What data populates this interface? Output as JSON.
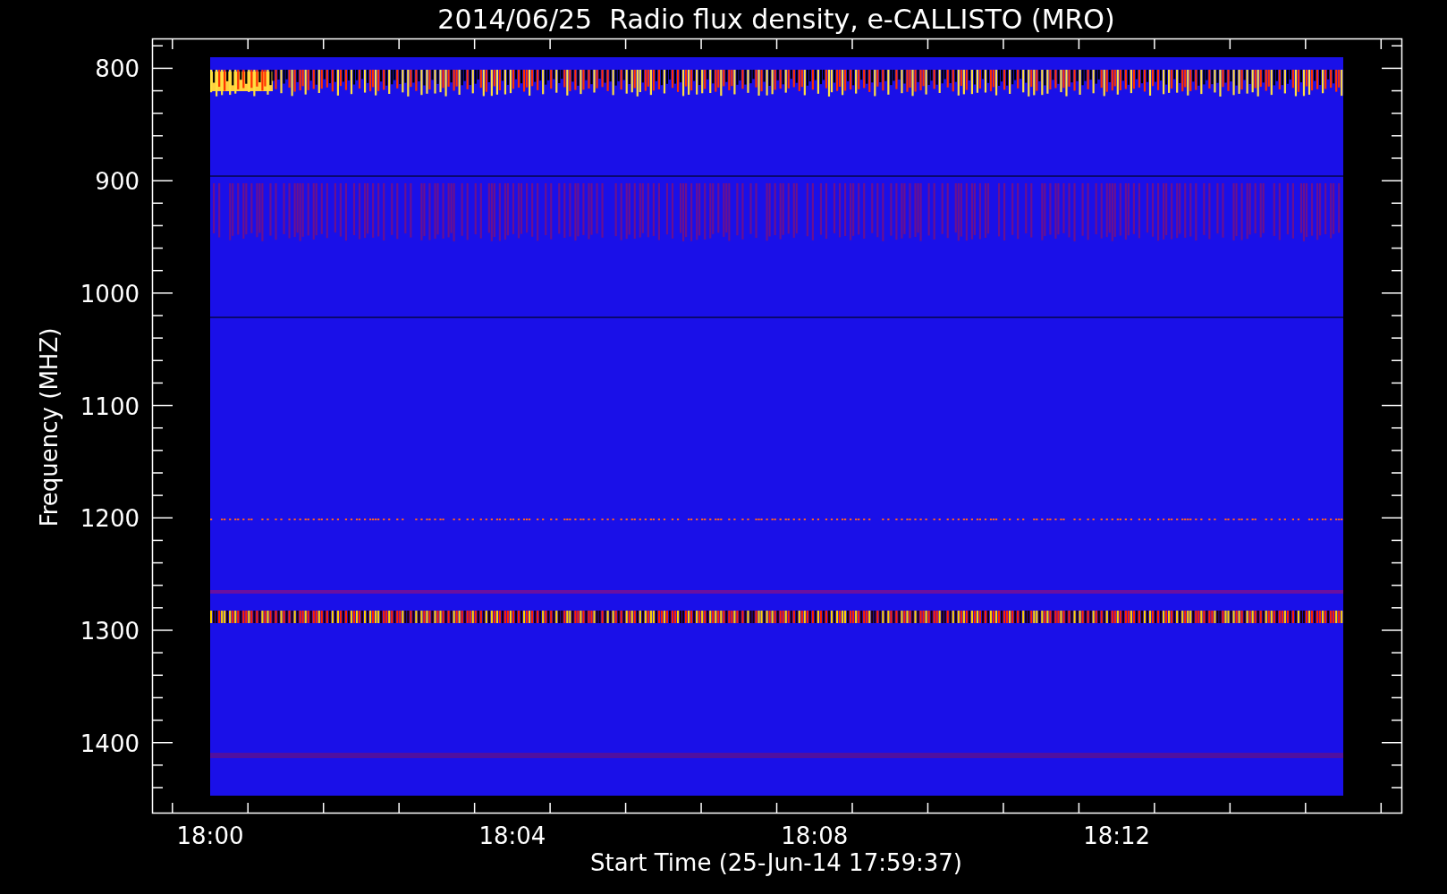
{
  "title": "2014/06/25  Radio flux density, e-CALLISTO (MRO)",
  "y_axis": {
    "label": "Frequency (MHZ)",
    "ticks": [
      "800",
      "900",
      "1000",
      "1100",
      "1200",
      "1300",
      "1400"
    ]
  },
  "x_axis": {
    "label": "Start Time (25-Jun-14 17:59:37)",
    "ticks": [
      "18:00",
      "18:04",
      "18:08",
      "18:12"
    ]
  }
}
